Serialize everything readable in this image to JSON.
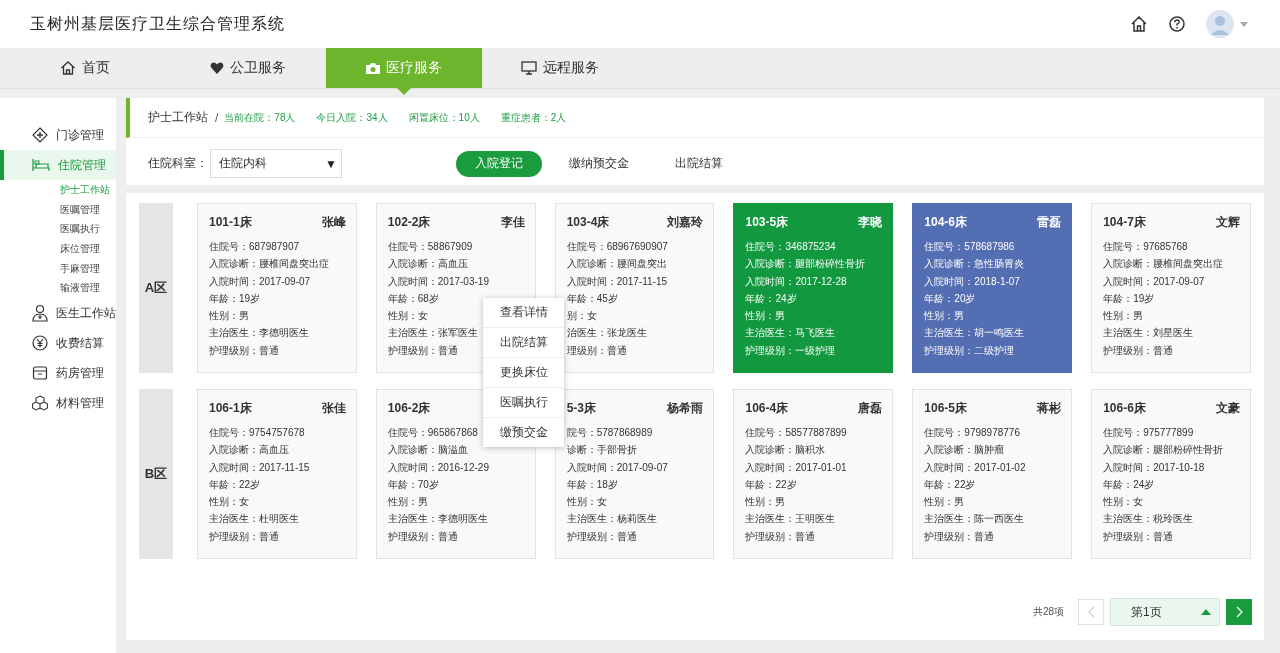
{
  "app_title": "玉树州基层医疗卫生综合管理系统",
  "nav_tabs": [
    {
      "label": "首页",
      "selected": false
    },
    {
      "label": "公卫服务",
      "selected": false
    },
    {
      "label": "医疗服务",
      "selected": true
    },
    {
      "label": "远程服务",
      "selected": false
    }
  ],
  "sidebar": [
    {
      "label": "门诊管理",
      "selected": false
    },
    {
      "label": "住院管理",
      "selected": true,
      "children": [
        {
          "label": "护士工作站",
          "selected": true
        },
        {
          "label": "医嘱管理",
          "selected": false
        },
        {
          "label": "医嘱执行",
          "selected": false
        },
        {
          "label": "床位管理",
          "selected": false
        },
        {
          "label": "手麻管理",
          "selected": false
        },
        {
          "label": "输液管理",
          "selected": false
        }
      ]
    },
    {
      "label": "医生工作站",
      "selected": false
    },
    {
      "label": "收费结算",
      "selected": false
    },
    {
      "label": "药房管理",
      "selected": false
    },
    {
      "label": "材料管理",
      "selected": false
    }
  ],
  "breadcrumb": {
    "title": "护士工作站",
    "separator": "/",
    "stats": [
      "当前在院：78人",
      "今日入院：34人",
      "闲置床位：10人",
      "重症患者：2人"
    ]
  },
  "filter": {
    "label": "住院科室：",
    "value": "住院内科",
    "caret": "▼"
  },
  "actions": [
    {
      "label": "入院登记",
      "selected": true
    },
    {
      "label": "缴纳预交金",
      "selected": false
    },
    {
      "label": "出院结算",
      "selected": false
    }
  ],
  "zones": [
    {
      "name": "A区",
      "beds": [
        {
          "bed": "101-1床",
          "patient": "张峰",
          "color": "#f9f9f9",
          "lines": [
            "住院号：687987907",
            "入院诊断：腰椎间盘突出症",
            "入院时间：2017-09-07",
            "年龄：19岁",
            "性别：男",
            "主治医生：李德明医生",
            "护理级别：普通"
          ]
        },
        {
          "bed": "102-2床",
          "patient": "李佳",
          "color": "#f9f9f9",
          "lines": [
            "住院号：58867909",
            "入院诊断：高血压",
            "入院时间：2017-03-19",
            "年龄：68岁",
            "性别：女",
            "主治医生：张军医生",
            "护理级别：普通"
          ]
        },
        {
          "bed": "103-4床",
          "patient": "刘嘉玲",
          "color": "#f9f9f9",
          "lines": [
            "住院号：68967690907",
            "入院诊断：腰间盘突出",
            "入院时间：2017-11-15",
            "年龄：45岁",
            "别：女",
            "治医生：张龙医生",
            "理级别：普通"
          ]
        },
        {
          "bed": "103-5床",
          "patient": "李晓",
          "color": "#12993f",
          "lines": [
            "住院号：346875234",
            "入院诊断：腿部粉碎性骨折",
            "入院时间：2017-12-28",
            "年龄：24岁",
            "性别：男",
            "主治医生：马飞医生",
            "护理级别：一级护理"
          ]
        },
        {
          "bed": "104-6床",
          "patient": "雷磊",
          "color": "#546eb4",
          "lines": [
            "住院号：578687986",
            "入院诊断：急性肠胃炎",
            "入院时间：2018-1-07",
            "年龄：20岁",
            "性别：男",
            "主治医生：胡一鸣医生",
            "护理级别：二级护理"
          ]
        },
        {
          "bed": "104-7床",
          "patient": "文辉",
          "color": "#f9f9f9",
          "lines": [
            "住院号：97685768",
            "入院诊断：腰椎间盘突出症",
            "入院时间：2017-09-07",
            "年龄：19岁",
            "性别：男",
            "主治医生：刘星医生",
            "护理级别：普通"
          ]
        }
      ]
    },
    {
      "name": "B区",
      "beds": [
        {
          "bed": "106-1床",
          "patient": "张佳",
          "color": "#f9f9f9",
          "lines": [
            "住院号：9754757678",
            "入院诊断：高血压",
            "入院时间：2017-11-15",
            "年龄：22岁",
            "性别：女",
            "主治医生：杜明医生",
            "护理级别：普通"
          ]
        },
        {
          "bed": "106-2床",
          "color": "#f9f9f9",
          "lines": [
            "住院号：965867868",
            "入院诊断：脑溢血",
            "入院时间：2016-12-29",
            "年龄：70岁",
            "性别：男",
            "主治医生：李德明医生",
            "护理级别：普通"
          ]
        },
        {
          "bed": "5-3床",
          "patient": "杨希雨",
          "color": "#f9f9f9",
          "lines": [
            "院号：5787868989",
            "诊断：手部骨折",
            "入院时间：2017-09-07",
            "年龄：18岁",
            "性别：女",
            "主治医生：杨莉医生",
            "护理级别：普通"
          ]
        },
        {
          "bed": "106-4床",
          "patient": "唐磊",
          "color": "#f9f9f9",
          "lines": [
            "住院号：58577887899",
            "入院诊断：脑积水",
            "入院时间：2017-01-01",
            "年龄：22岁",
            "性别：男",
            "主治医生：王明医生",
            "护理级别：普通"
          ]
        },
        {
          "bed": "106-5床",
          "patient": "蒋彬",
          "color": "#f9f9f9",
          "lines": [
            "住院号：9798978776",
            "入院诊断：脑肿瘤",
            "入院时间：2017-01-02",
            "年龄：22岁",
            "性别：男",
            "主治医生：陈一西医生",
            "护理级别：普通"
          ]
        },
        {
          "bed": "106-6床",
          "patient": "文豪",
          "color": "#f9f9f9",
          "lines": [
            "住院号：975777899",
            "入院诊断：腿部粉碎性骨折",
            "入院时间：2017-10-18",
            "年龄：24岁",
            "性别：女",
            "主治医生：税玲医生",
            "护理级别：普通"
          ]
        }
      ]
    }
  ],
  "context_menu": [
    "查看详情",
    "出院结算",
    "更换床位",
    "医嘱执行",
    "缴预交金"
  ],
  "pagination": {
    "total": "共28项",
    "page": "第1页",
    "prev_disabled": true
  }
}
